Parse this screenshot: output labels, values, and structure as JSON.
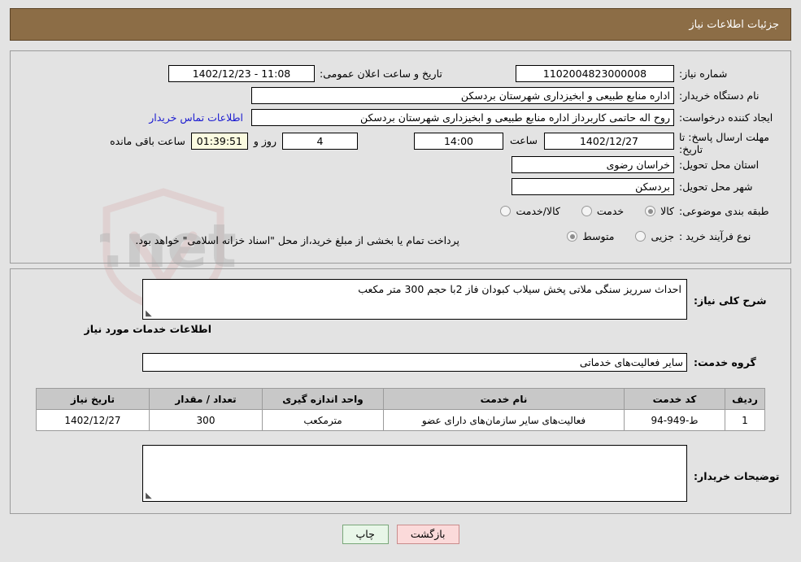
{
  "header": {
    "title": "جزئیات اطلاعات نیاز",
    "bg_color": "#8c6d46"
  },
  "fields": {
    "need_number_label": "شماره نیاز:",
    "need_number_value": "1102004823000008",
    "announce_datetime_label": "تاریخ و ساعت اعلان عمومی:",
    "announce_datetime_value": "11:08 - 1402/12/23",
    "buyer_org_label": "نام دستگاه خریدار:",
    "buyer_org_value": "اداره منابع طبیعی و ابخیزداری شهرستان بردسکن",
    "requester_label": "ایجاد کننده درخواست:",
    "requester_value": "روح اله حاتمی کاربرداز اداره منابع طبیعی و ابخیزداری شهرستان بردسکن",
    "contact_link": "اطلاعات تماس خریدار",
    "deadline_label": "مهلت ارسال پاسخ: تا تاریخ:",
    "deadline_date": "1402/12/27",
    "hour_label": "ساعت",
    "deadline_time": "14:00",
    "days_remaining": "4",
    "days_label": "روز و",
    "countdown": "01:39:51",
    "remaining_suffix": "ساعت باقی مانده",
    "province_label": "استان محل تحویل:",
    "province_value": "خراسان رضوی",
    "city_label": "شهر محل تحویل:",
    "city_value": "بردسکن",
    "category_label": "طبقه بندی موضوعی:",
    "purchase_type_label": "نوع فرآیند خرید :",
    "payment_note": "پرداخت تمام یا بخشی از مبلغ خرید،از محل \"اسناد خزانه اسلامی\" خواهد بود."
  },
  "category_options": [
    {
      "label": "کالا",
      "checked": true
    },
    {
      "label": "خدمت",
      "checked": false
    },
    {
      "label": "کالا/خدمت",
      "checked": false
    }
  ],
  "purchase_options": [
    {
      "label": "جزیی",
      "checked": false
    },
    {
      "label": "متوسط",
      "checked": true
    }
  ],
  "description": {
    "need_summary_label": "شرح کلی نیاز:",
    "need_summary_value": "احداث سرریز سنگی ملاتی پخش سیلاب کبودان فاز 2با حجم 300 متر مکعب",
    "services_heading": "اطلاعات خدمات مورد نیاز",
    "service_group_label": "گروه خدمت:",
    "service_group_value": "سایر فعالیت‌های خدماتی",
    "buyer_notes_label": "توضیحات خریدار:",
    "buyer_notes_value": ""
  },
  "table": {
    "columns": [
      "ردیف",
      "کد خدمت",
      "نام خدمت",
      "واحد اندازه گیری",
      "تعداد / مقدار",
      "تاریخ نیاز"
    ],
    "rows": [
      {
        "row": "1",
        "code": "ط-949-94",
        "name": "فعالیت‌های سایر سازمان‌های دارای عضو",
        "unit": "مترمکعب",
        "quantity": "300",
        "date": "1402/12/27"
      }
    ]
  },
  "buttons": {
    "print": "چاپ",
    "back": "بازگشت"
  },
  "watermark": {
    "text": "AriaTender.net"
  }
}
